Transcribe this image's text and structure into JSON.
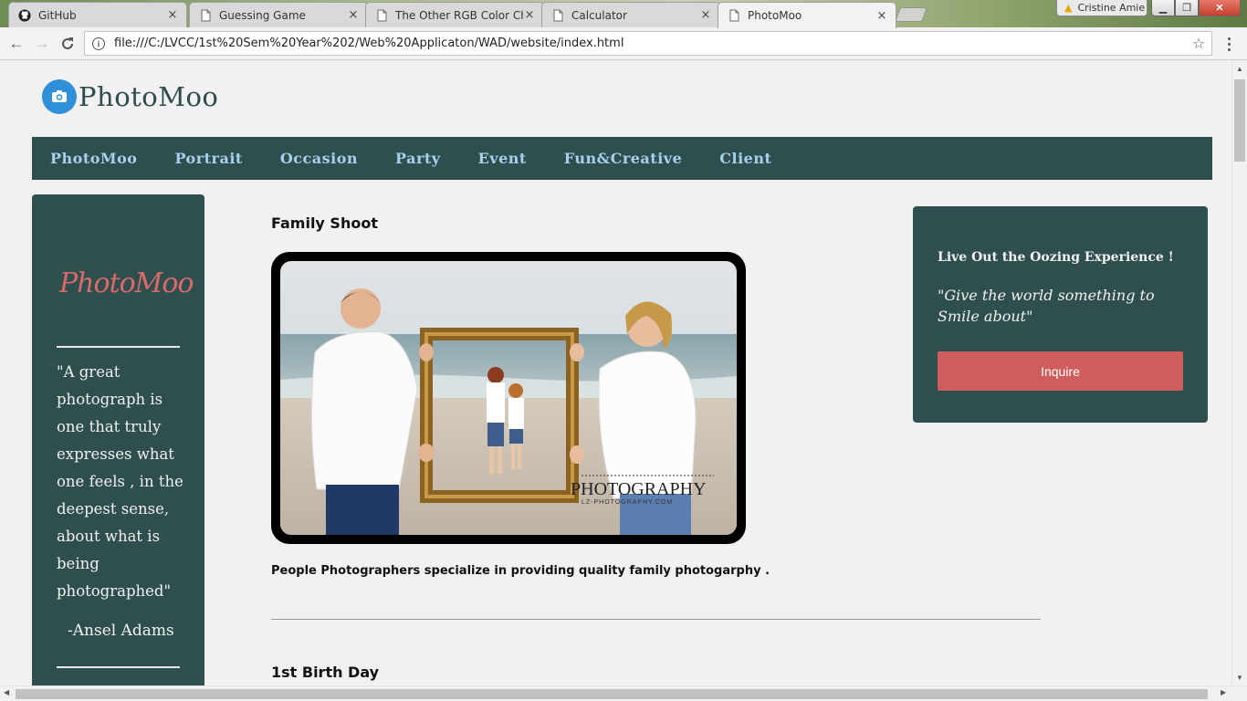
{
  "browser": {
    "tabs": [
      {
        "title": "GitHub",
        "icon": "github-icon",
        "active": false
      },
      {
        "title": "Guessing Game",
        "icon": "page-icon",
        "active": false
      },
      {
        "title": "The Other RGB Color Ch",
        "icon": "page-icon",
        "active": false
      },
      {
        "title": "Calculator",
        "icon": "page-icon",
        "active": false
      },
      {
        "title": "PhotoMoo",
        "icon": "page-icon",
        "active": true
      }
    ],
    "close_glyph": "×",
    "user": "Cristine Amie",
    "url": "file:///C:/LVCC/1st%20Sem%20Year%202/Web%20Applicaton/WAD/website/index.html"
  },
  "site": {
    "logo_text": "PhotoMoo",
    "nav": [
      "PhotoMoo",
      "Portrait",
      "Occasion",
      "Party",
      "Event",
      "Fun&Creative",
      "Client"
    ]
  },
  "sidebar": {
    "script_logo": "PhotoMoo",
    "quote": "\"A great photograph is one that truly expresses what one feels , in the deepest sense, about what is being photographed\"",
    "author": "-Ansel Adams"
  },
  "main": {
    "section1_title": "Family Shoot",
    "watermark": "PHOTOGRAPHY",
    "watermark_sub": "LZ-PHOTOGRAPHY.COM",
    "caption": "People Photographers specialize in providing quality family photogarphy .",
    "section2_title": "1st Birth Day"
  },
  "promo": {
    "headline": "Live Out the Oozing Experience !",
    "tagline": "\"Give the world something to Smile about\"",
    "button": "Inquire"
  },
  "colors": {
    "panel": "#2f4f4f",
    "nav_link": "#a9cfee",
    "accent_button": "#d05d5d",
    "logo_blue": "#2f8fd8"
  }
}
